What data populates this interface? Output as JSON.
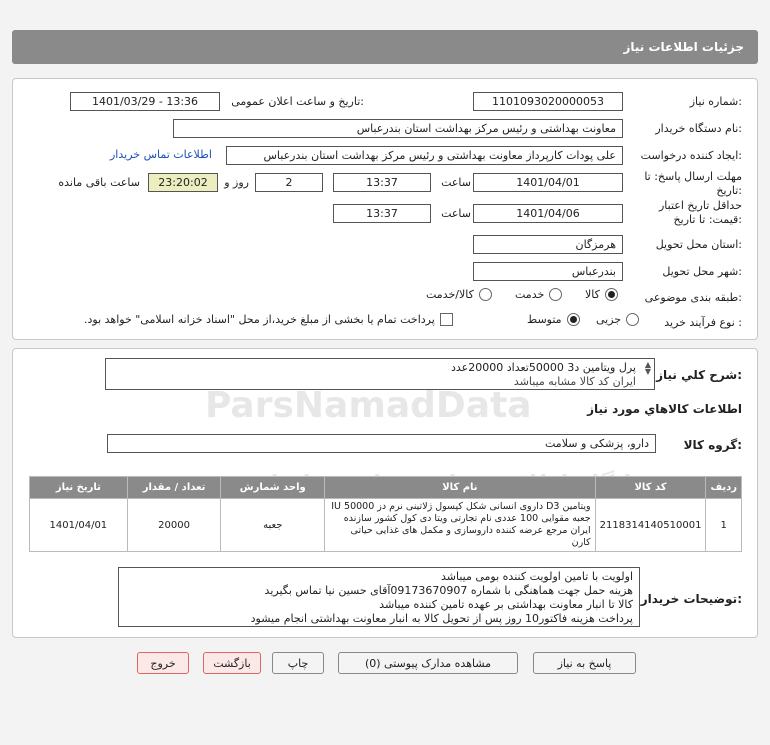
{
  "header": {
    "title": "جزئیات اطلاعات نیاز"
  },
  "fields": {
    "need_number": {
      "label": "شماره نیاز:",
      "value": "1101093020000053"
    },
    "announce_datetime": {
      "label": "تاریخ و ساعت اعلان عمومی:",
      "value": "1401/03/29 - 13:36"
    },
    "buyer_org": {
      "label": "نام دستگاه خریدار:",
      "value": "معاونت  بهداشتی و رئیس مرکز بهداشت استان بندرعباس"
    },
    "requester": {
      "label": "ایجاد کننده درخواست:",
      "value": "علی پودات کارپرداز معاونت  بهداشتی و رئیس مرکز بهداشت استان بندرعباس",
      "contact_link": "اطلاعات تماس خریدار"
    },
    "reply_deadline": {
      "label_line1": "مهلت ارسال پاسخ: تا",
      "label_line2": "تاریخ:",
      "date": "1401/04/01",
      "time_label": "ساعت",
      "time": "13:37",
      "days": "2",
      "days_label": "روز و",
      "remaining": "23:20:02",
      "remaining_label": "ساعت باقی مانده"
    },
    "price_validity": {
      "label_line1": "حداقل تاریخ اعتبار",
      "label_line2": "قیمت: تا تاریخ:",
      "date": "1401/04/06",
      "time_label": "ساعت",
      "time": "13:37"
    },
    "delivery_province": {
      "label": "استان محل تحویل:",
      "value": "هرمزگان"
    },
    "delivery_city": {
      "label": "شهر محل تحویل:",
      "value": "بندرعباس"
    },
    "category": {
      "label": "طبقه بندی موضوعی:",
      "options": [
        "کالا",
        "خدمت",
        "کالا/خدمت"
      ],
      "selected": "کالا"
    },
    "purchase_process": {
      "label": "نوع فرآیند خرید :",
      "options": [
        "جزیی",
        "متوسط"
      ],
      "selected": "متوسط",
      "payment_note": "پرداخت تمام یا بخشی از مبلغ خرید،از محل \"اسناد خزانه اسلامی\" خواهد بود."
    }
  },
  "summary": {
    "label": "شرح کلي نياز:",
    "line1": "پرل ویتامین د3 50000تعداد 20000عدد",
    "line2": "ایران کد کالا مشابه میباشد"
  },
  "goods_info": {
    "title": "اطلاعات کالاهاي مورد نياز",
    "group_label": "گروه کالا:",
    "group_value": "دارو، پزشکی و سلامت"
  },
  "table": {
    "headers": [
      "ردیف",
      "کد کالا",
      "نام کالا",
      "واحد شمارش",
      "تعداد / مقدار",
      "تاریخ نیاز"
    ],
    "rows": [
      {
        "row": "1",
        "code": "2118314140510001",
        "name": "ویتامین D3 داروی انسانی شکل کپسول ژلاتینی نرم دز IU 50000 جعبه مقوایی 100 عددی نام تجارتی ویتا دی کول کشور سازنده ایران مرجع عرضه کننده داروسازی و مکمل های غذایی حیاتی کارن",
        "unit": "جعبه",
        "qty": "20000",
        "date": "1401/04/01"
      }
    ]
  },
  "buyer_notes": {
    "label": "توضیحات خریدار:",
    "lines": [
      "اولویت با تامین اولویت کننده بومی میباشد",
      "هزینه حمل جهت هماهنگی با شماره 09173670907آقای حسین نیا تماس بگیرید",
      "کالا تا انبار  معاونت بهداشتی بر عهده تامین کننده میباشد",
      "پرداخت هزینه فاکتور10 روز پس از تحویل کالا به انبار معاونت بهداشتی  انجام میشود"
    ]
  },
  "buttons": {
    "reply": "پاسخ به نیاز",
    "view_docs": "مشاهده مدارک پیوستی (0)",
    "print": "چاپ",
    "back": "بازگشت",
    "exit": "خروج"
  },
  "watermark": {
    "brand": "ParsNamadData",
    "tagline": "پایگاه اطلاع رسانی مناقصه ایران",
    "phone": "۰۲۱ - ۸۸۳۴۹۶۷۰"
  }
}
